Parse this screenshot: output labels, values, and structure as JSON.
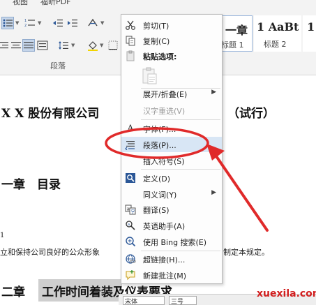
{
  "ribbon": {
    "tabs": [
      "视图",
      "福昕PDF"
    ],
    "group_label": "段落",
    "styles": [
      {
        "preview": "一章",
        "name": "标题 1"
      },
      {
        "preview": "1 AaBt",
        "name": "标题 2"
      },
      {
        "preview": "1",
        "name": ""
      }
    ]
  },
  "document": {
    "title_left": "X X 股份有限公司",
    "title_right": "（试行）",
    "chapter1": "一章　目录",
    "marker": "1",
    "body_left": "立和保持公司良好的公众形象",
    "body_right": "制定本规定。",
    "chapter2_prefix": "二章",
    "chapter2_title": "工作时间着装及仪表要求",
    "bottom_field1": "宋体",
    "bottom_field2": "三号"
  },
  "menu": {
    "items": [
      {
        "label": "剪切(T)",
        "icon": "cut-icon"
      },
      {
        "label": "复制(C)",
        "icon": "copy-icon"
      },
      {
        "label": "粘贴选项:",
        "icon": "paste-icon"
      },
      {
        "label": "展开/折叠(E)",
        "icon": ""
      },
      {
        "label": "汉字重选(V)",
        "icon": ""
      },
      {
        "label": "字体(F)...",
        "icon": "font-icon"
      },
      {
        "label": "段落(P)...",
        "icon": "paragraph-icon"
      },
      {
        "label": "插入符号(S)",
        "icon": ""
      },
      {
        "label": "定义(D)",
        "icon": "define-icon"
      },
      {
        "label": "同义词(Y)",
        "icon": ""
      },
      {
        "label": "翻译(S)",
        "icon": "translate-icon"
      },
      {
        "label": "英语助手(A)",
        "icon": "english-assistant-icon"
      },
      {
        "label": "使用 Bing 搜索(E)",
        "icon": "bing-search-icon"
      },
      {
        "label": "超链接(H)...",
        "icon": "hyperlink-icon"
      },
      {
        "label": "新建批注(M)",
        "icon": "new-comment-icon"
      }
    ]
  },
  "watermark": "xuexila.com",
  "colors": {
    "annotation": "#e02a2a",
    "menu_highlight": "#d8e6f5",
    "ribbon_bg": "#f3f3f3"
  }
}
